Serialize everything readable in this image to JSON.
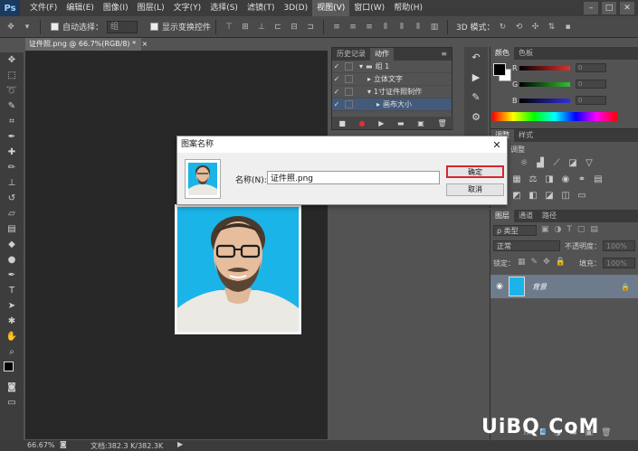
{
  "menubar": {
    "logo": "Ps",
    "items": [
      "文件(F)",
      "编辑(E)",
      "图像(I)",
      "图层(L)",
      "文字(Y)",
      "选择(S)",
      "滤镜(T)",
      "3D(D)",
      "视图(V)",
      "窗口(W)",
      "帮助(H)"
    ],
    "active_index": 8,
    "window_controls": [
      "–",
      "□",
      "✕"
    ]
  },
  "options_bar": {
    "auto_select_label": "自动选择：",
    "auto_select_value": "组",
    "transform_controls_label": "显示变换控件",
    "mode_3d_label": "3D 模式："
  },
  "document": {
    "tab_label": "证件照.png @ 66.7%(RGB/8) *",
    "tab_close": "×"
  },
  "history_panel": {
    "tabs": [
      "历史记录",
      "动作"
    ],
    "active_tab": 1,
    "rows": [
      {
        "label": "组 1",
        "indent": 0
      },
      {
        "label": "立体文字",
        "indent": 1
      },
      {
        "label": "1寸证件照制作",
        "indent": 1
      },
      {
        "label": "画布大小",
        "indent": 2
      }
    ]
  },
  "color_panel": {
    "tabs": [
      "颜色",
      "色板"
    ],
    "active_tab": 0,
    "channels": [
      {
        "label": "R",
        "value": "0",
        "color": "#e03030"
      },
      {
        "label": "G",
        "value": "0",
        "color": "#30c030"
      },
      {
        "label": "B",
        "value": "0",
        "color": "#3030e0"
      }
    ]
  },
  "adjustments_panel": {
    "tabs": [
      "调整",
      "样式"
    ],
    "active_tab": 0,
    "heading": "调整"
  },
  "layers_panel": {
    "tabs": [
      "图层",
      "通道",
      "路径"
    ],
    "active_tab": 0,
    "kind_filter": "ρ 类型",
    "blend_mode": "正常",
    "opacity_label": "不透明度：",
    "opacity_value": "100%",
    "lock_label": "锁定：",
    "fill_label": "填充：",
    "fill_value": "100%",
    "layer_name": "背景"
  },
  "dialog": {
    "title": "图案名称",
    "close": "✕",
    "name_label": "名称(N):",
    "name_value": "证件照.png",
    "ok_label": "确定",
    "cancel_label": "取消"
  },
  "status_bar": {
    "zoom": "66.67%",
    "doc_info": "文档:382.3 K/382.3K"
  },
  "watermark": {
    "text_left": "UiBQ",
    "text_dot": ".",
    "text_right": "CoM"
  },
  "colors": {
    "accent_red": "#d8262e",
    "layer_selected": "#6d7b8c",
    "photo_bg": "#1ab4e8"
  }
}
